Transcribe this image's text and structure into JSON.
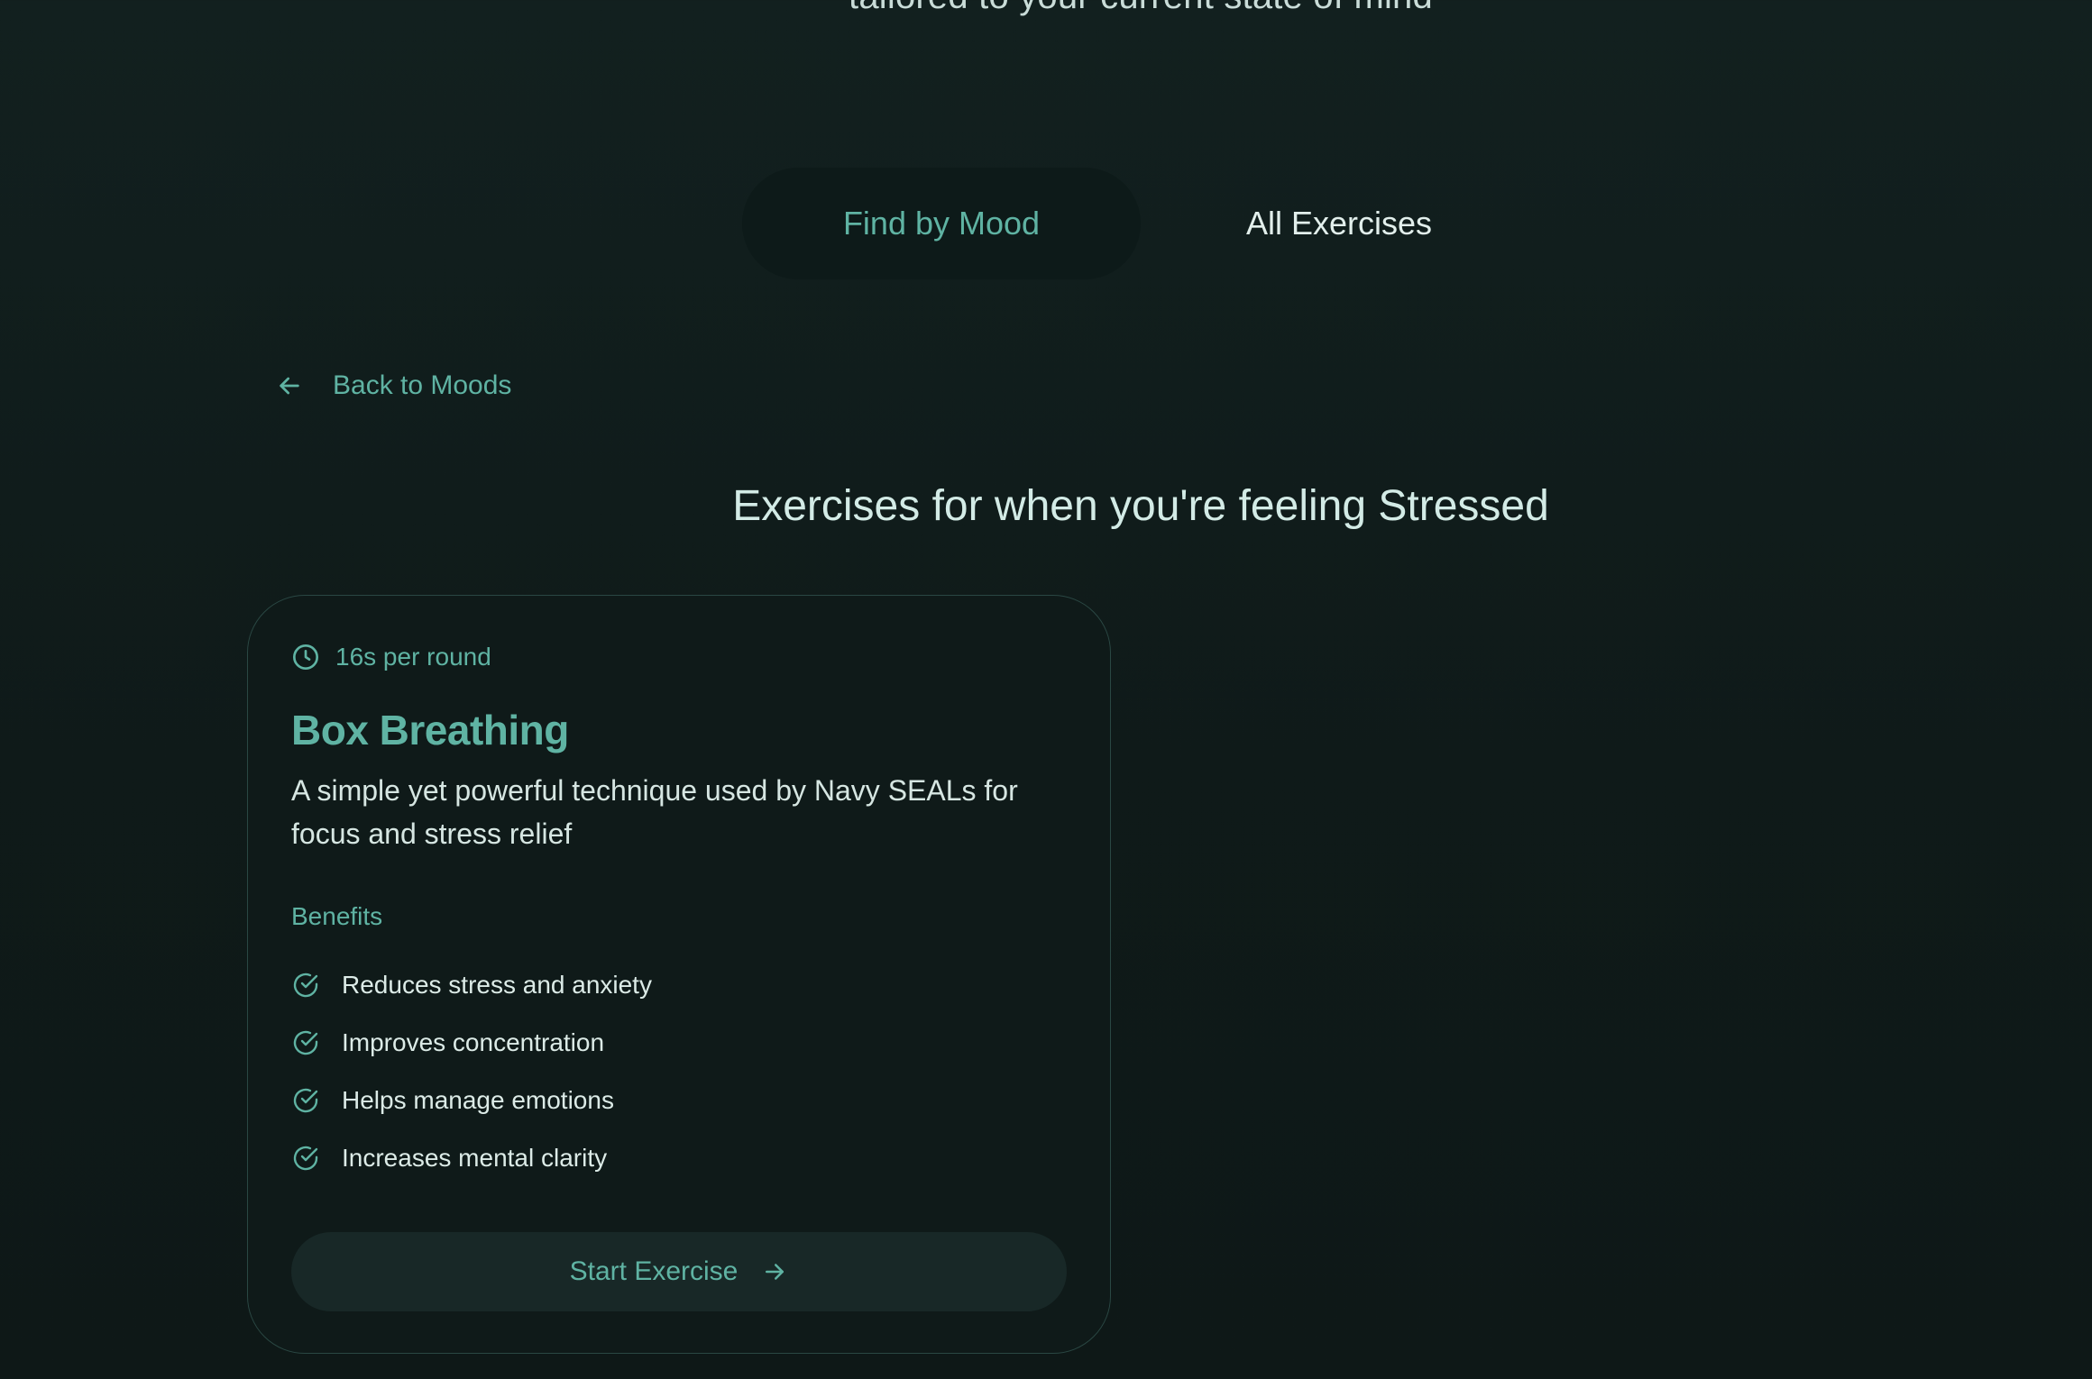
{
  "header": {
    "subtitle": "tailored to your current state of mind"
  },
  "tabs": [
    {
      "label": "Find by Mood",
      "active": true
    },
    {
      "label": "All Exercises",
      "active": false
    }
  ],
  "back_link": {
    "label": "Back to Moods",
    "icon": "arrow-left-icon"
  },
  "section": {
    "heading": "Exercises for when you're feeling Stressed"
  },
  "exercise_card": {
    "duration": "16s per round",
    "duration_icon": "clock-icon",
    "title": "Box Breathing",
    "description": "A simple yet powerful technique used by Navy SEALs for focus and stress relief",
    "benefits_heading": "Benefits",
    "benefit_icon": "check-circle-icon",
    "benefits": [
      "Reduces stress and anxiety",
      "Improves concentration",
      "Helps manage emotions",
      "Increases mental clarity"
    ],
    "start_button": {
      "label": "Start Exercise",
      "icon": "arrow-right-icon"
    }
  },
  "colors": {
    "background": "#101c1b",
    "accent": "#5fb3a3",
    "text": "#d6e6e2",
    "card_border": "#2a4743",
    "button_bg": "#182827"
  }
}
